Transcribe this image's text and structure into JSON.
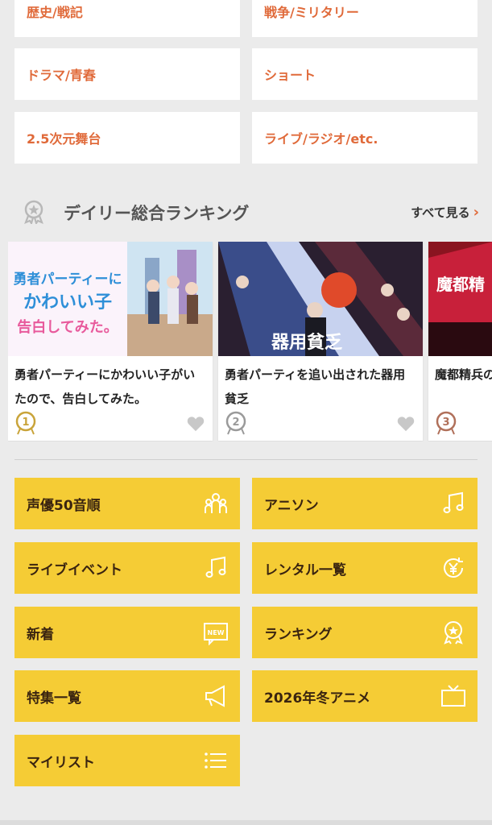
{
  "genres": [
    {
      "label": "歴史/戦記"
    },
    {
      "label": "戦争/ミリタリー"
    },
    {
      "label": "ドラマ/青春"
    },
    {
      "label": "ショート"
    },
    {
      "label": "2.5次元舞台"
    },
    {
      "label": "ライブ/ラジオ/etc."
    }
  ],
  "ranking": {
    "title": "デイリー総合ランキング",
    "see_all": "すべて見る",
    "items": [
      {
        "title": "勇者パーティーにかわいい子がいたので、告白してみた。",
        "rank": "1",
        "thumb_text": "勇者パーティーにかわいい子がいたので、告白してみた。"
      },
      {
        "title": "勇者パーティを追い出された器用貧乏",
        "rank": "2",
        "thumb_text": "器用貧乏"
      },
      {
        "title": "魔都精兵の Ver.》",
        "rank": "3",
        "thumb_text": "魔都精"
      }
    ]
  },
  "nav": [
    {
      "label": "声優50音順",
      "icon": "people-icon"
    },
    {
      "label": "アニソン",
      "icon": "music-note-icon"
    },
    {
      "label": "ライブイベント",
      "icon": "music-note-icon"
    },
    {
      "label": "レンタル一覧",
      "icon": "yen-rental-icon"
    },
    {
      "label": "新着",
      "icon": "new-badge-icon"
    },
    {
      "label": "ランキング",
      "icon": "ranking-medal-icon"
    },
    {
      "label": "特集一覧",
      "icon": "megaphone-icon"
    },
    {
      "label": "2026年冬アニメ",
      "icon": "tv-icon"
    },
    {
      "label": "マイリスト",
      "icon": "list-icon"
    }
  ],
  "colors": {
    "accent": "#e06a3a",
    "button_yellow": "#f5cc35",
    "background": "#ebebeb"
  }
}
